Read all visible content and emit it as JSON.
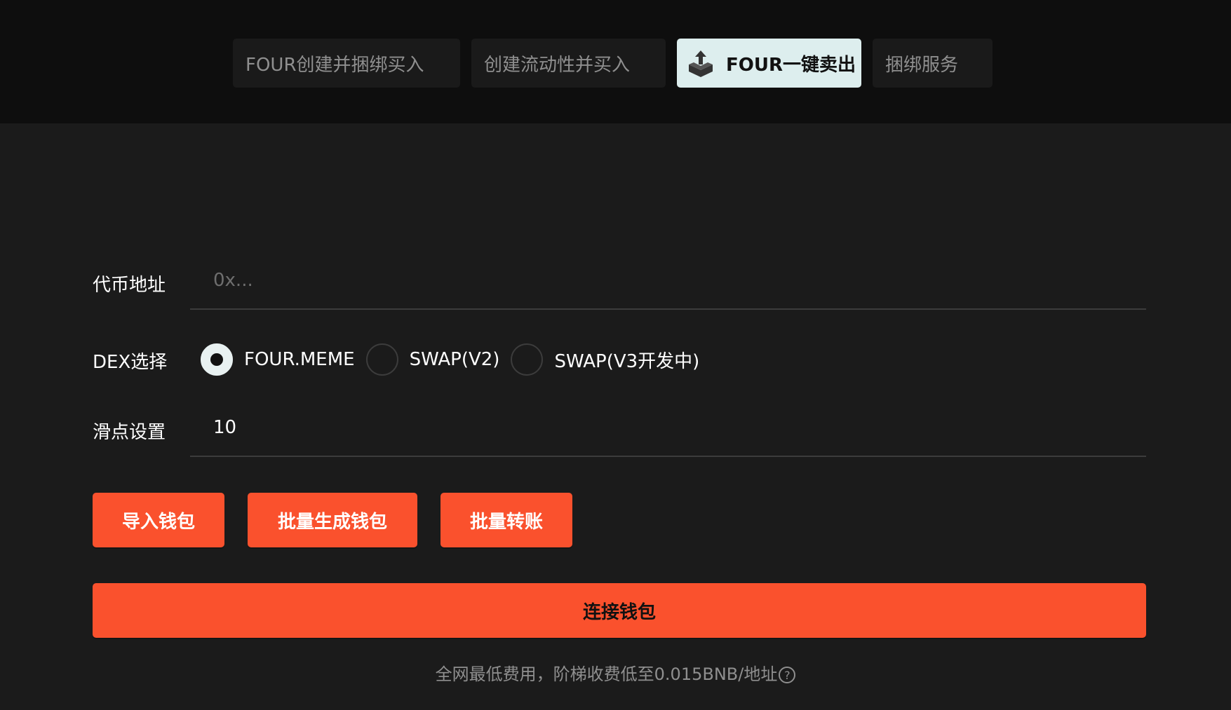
{
  "tabs": [
    {
      "label": "FOUR创建并捆绑买入",
      "active": false
    },
    {
      "label": "创建流动性并买入",
      "active": false
    },
    {
      "label": "FOUR一键卖出",
      "active": true,
      "icon": "upload-box-icon"
    },
    {
      "label": "捆绑服务",
      "active": false
    }
  ],
  "form": {
    "token_address": {
      "label": "代币地址",
      "value": "",
      "placeholder": "0x..."
    },
    "dex": {
      "label": "DEX选择",
      "options": [
        {
          "label": "FOUR.MEME",
          "checked": true
        },
        {
          "label": "SWAP(V2)",
          "checked": false
        },
        {
          "label": "SWAP(V3开发中)",
          "checked": false
        }
      ]
    },
    "slippage": {
      "label": "滑点设置",
      "value": "10"
    }
  },
  "actions": {
    "import_wallet": "导入钱包",
    "batch_generate_wallet": "批量生成钱包",
    "batch_transfer": "批量转账",
    "connect_wallet": "连接钱包"
  },
  "footer": {
    "fee_note": "全网最低费用，阶梯收费低至0.015BNB/地址",
    "help_icon": "?"
  },
  "colors": {
    "background": "#1b1b1b",
    "topbar": "#0e0e0e",
    "accent": "#fa512d",
    "active_tab": "#ddeeee"
  }
}
